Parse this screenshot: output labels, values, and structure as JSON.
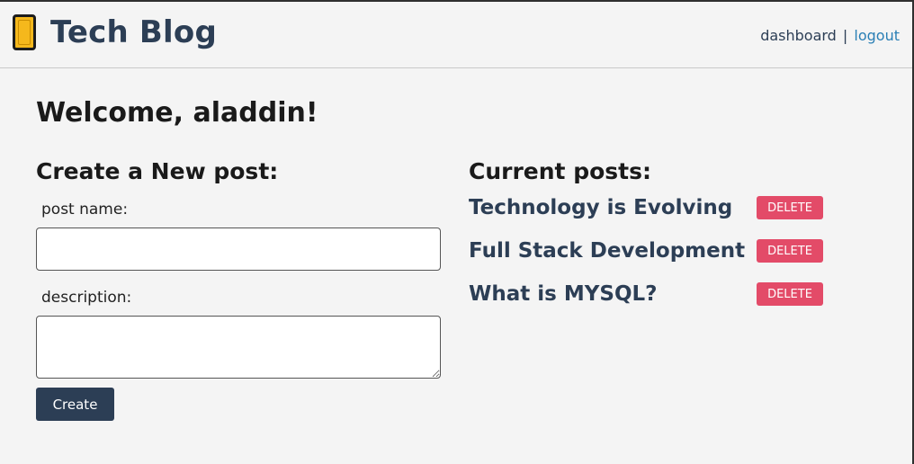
{
  "header": {
    "title": "Tech Blog",
    "nav": {
      "dashboard": "dashboard",
      "separator": "|",
      "logout": "logout"
    }
  },
  "welcome": "Welcome, aladdin!",
  "create_form": {
    "heading": "Create a New post:",
    "post_name_label": "post name:",
    "post_name_value": "",
    "description_label": "description:",
    "description_value": "",
    "submit_label": "Create"
  },
  "current_posts": {
    "heading": "Current posts:",
    "items": [
      {
        "title": "Technology is Evolving",
        "delete_label": "DELETE"
      },
      {
        "title": "Full Stack Development",
        "delete_label": "DELETE"
      },
      {
        "title": "What is MYSQL?",
        "delete_label": "DELETE"
      }
    ]
  },
  "colors": {
    "brand": "#2c3e55",
    "link": "#2a7fb5",
    "delete": "#e34b68",
    "background": "#f4f4f4"
  },
  "icons": {
    "brand_icon": "notebook-icon"
  }
}
